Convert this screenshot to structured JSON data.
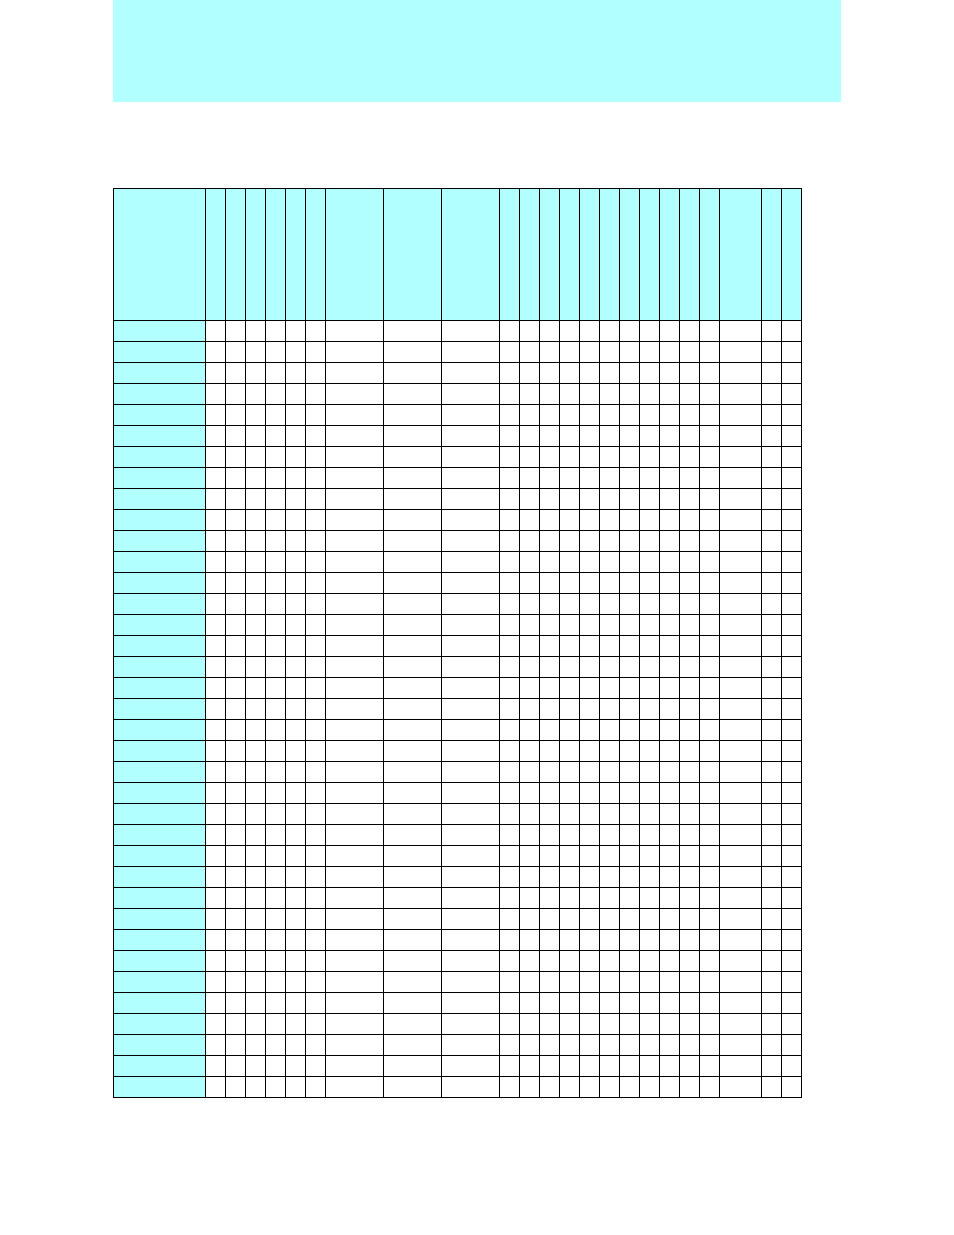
{
  "colors": {
    "accent": "#b2ffff",
    "border": "#000000",
    "page": "#ffffff"
  },
  "banner": {
    "text": ""
  },
  "grid": {
    "columns": 24,
    "rows": 37,
    "header_cells": [
      "",
      "",
      "",
      "",
      "",
      "",
      "",
      "",
      "",
      "",
      "",
      "",
      "",
      "",
      "",
      "",
      "",
      "",
      "",
      "",
      "",
      "",
      "",
      ""
    ],
    "row_headers": [
      "",
      "",
      "",
      "",
      "",
      "",
      "",
      "",
      "",
      "",
      "",
      "",
      "",
      "",
      "",
      "",
      "",
      "",
      "",
      "",
      "",
      "",
      "",
      "",
      "",
      "",
      "",
      "",
      "",
      "",
      "",
      "",
      "",
      "",
      "",
      "",
      ""
    ]
  }
}
